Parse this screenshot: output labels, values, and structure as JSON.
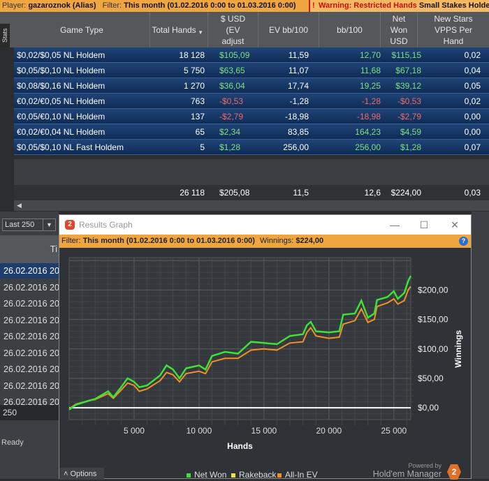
{
  "topbar": {
    "player_label": "Player:",
    "player": "gazaroznok (Alias)",
    "filter_label": "Filter:",
    "filter": "This month (01.02.2016 0:00 to 01.03.2016 0:00)",
    "warning": "Warning: Restricted Hands",
    "warning_detail": "Small Stakes Holdem"
  },
  "stats_tab": "Stats",
  "columns": [
    "Game Type",
    "Total Hands",
    "$ USD (EV adjust",
    "EV bb/100",
    "bb/100",
    "Net Won USD",
    "New Stars VPPS Per Hand"
  ],
  "rows": [
    [
      "$0,02/$0,05 NL Holdem",
      "18 128",
      "$105,09",
      "11,59",
      "12,70",
      "$115,15",
      "0,02"
    ],
    [
      "$0,05/$0,10 NL Holdem",
      "5 750",
      "$63,65",
      "11,07",
      "11,68",
      "$67,18",
      "0,04"
    ],
    [
      "$0,08/$0,16 NL Holdem",
      "1 270",
      "$36,04",
      "17,74",
      "19,25",
      "$39,12",
      "0,05"
    ],
    [
      "€0,02/€0,05 NL Holdem",
      "763",
      "-$0,53",
      "-1,28",
      "-1,28",
      "-$0,53",
      "0,02"
    ],
    [
      "€0,05/€0,10 NL Holdem",
      "137",
      "-$2,79",
      "-18,98",
      "-18,98",
      "-$2,79",
      "0,00"
    ],
    [
      "€0,02/€0,04 NL Holdem",
      "65",
      "$2,34",
      "83,85",
      "164,23",
      "$4,59",
      "0,00"
    ],
    [
      "$0,05/$0,10 NL Fast Holdem",
      "5",
      "$1,28",
      "256,00",
      "256,00",
      "$1,28",
      "0,07"
    ]
  ],
  "totals": [
    "26 118",
    "$205,08",
    "11,5",
    "12,6",
    "$224,00",
    "0,03"
  ],
  "left": {
    "dropdown": "Last 250",
    "header": "Ti",
    "dates": [
      "26.02.2016 20",
      "26.02.2016 20",
      "26.02.2016 20",
      "26.02.2016 20",
      "26.02.2016 20",
      "26.02.2016 20",
      "26.02.2016 20",
      "26.02.2016 20",
      "26.02.2016 20"
    ],
    "count": "250",
    "status": "Ready"
  },
  "graph": {
    "title": "Results Graph",
    "logo": "2",
    "filter_label": "Filter:",
    "filter": "This month (01.02.2016 0:00 to 01.03.2016 0:00)",
    "winnings_label": "Winnings:",
    "winnings": "$224,00",
    "help": "?",
    "options": "Options",
    "powered_by": "Powered by",
    "brand": "Hold'em Manager",
    "legend": [
      "Net Won",
      "Rakeback",
      "All-In EV"
    ]
  },
  "colors": {
    "net_won": "#3ee03a",
    "rakeback": "#f0e040",
    "allin_ev": "#f0902a",
    "orange": "#f0a640"
  },
  "chart_data": {
    "type": "line",
    "xlabel": "Hands",
    "ylabel": "Winnings",
    "xlim": [
      0,
      26300
    ],
    "ylim": [
      -20,
      255
    ],
    "xticks": [
      5000,
      10000,
      15000,
      20000,
      25000
    ],
    "xtick_labels": [
      "5 000",
      "10 000",
      "15 000",
      "20 000",
      "25 000"
    ],
    "yticks": [
      0,
      50,
      100,
      150,
      200
    ],
    "ytick_labels": [
      "$0,00",
      "$50,00",
      "$100,00",
      "$150,00",
      "$200,00"
    ],
    "series": [
      {
        "name": "All-In EV",
        "x": [
          0,
          500,
          1500,
          2000,
          3000,
          3400,
          4000,
          4500,
          5000,
          5400,
          6000,
          7000,
          7500,
          8000,
          8500,
          9000,
          10000,
          10500,
          11000,
          12000,
          13000,
          14000,
          15000,
          16000,
          16500,
          17000,
          18000,
          18300,
          18600,
          19000,
          20000,
          20800,
          21100,
          22000,
          22500,
          23000,
          23500,
          23700,
          24500,
          25000,
          25300,
          25800,
          26100,
          26300
        ],
        "y": [
          -2,
          6,
          12,
          14,
          24,
          16,
          30,
          42,
          38,
          28,
          32,
          46,
          60,
          56,
          44,
          58,
          62,
          58,
          78,
          84,
          84,
          98,
          100,
          98,
          104,
          110,
          112,
          128,
          136,
          122,
          118,
          120,
          142,
          148,
          168,
          145,
          150,
          172,
          178,
          185,
          176,
          182,
          200,
          206
        ]
      },
      {
        "name": "Net Won",
        "x": [
          0,
          500,
          1500,
          2000,
          3000,
          3400,
          4000,
          4500,
          5000,
          5400,
          6000,
          7000,
          7500,
          8000,
          8500,
          9000,
          10000,
          10500,
          11000,
          12000,
          13000,
          14000,
          15000,
          16000,
          16500,
          17000,
          18000,
          18300,
          18600,
          19000,
          20000,
          20800,
          21100,
          22000,
          22500,
          23000,
          23500,
          23700,
          24500,
          25000,
          25300,
          25800,
          26100,
          26300
        ],
        "y": [
          -3,
          5,
          12,
          15,
          28,
          18,
          35,
          50,
          44,
          35,
          38,
          55,
          72,
          65,
          50,
          67,
          72,
          65,
          88,
          95,
          92,
          112,
          110,
          108,
          115,
          122,
          125,
          140,
          146,
          130,
          128,
          130,
          158,
          160,
          182,
          153,
          160,
          183,
          188,
          198,
          185,
          195,
          215,
          224
        ]
      }
    ]
  }
}
